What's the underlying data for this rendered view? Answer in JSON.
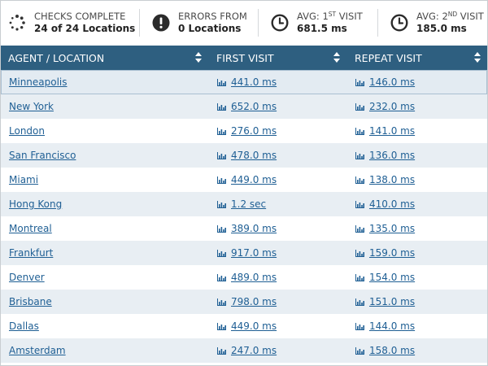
{
  "summary": {
    "checks": {
      "icon": "loading-spinner-icon",
      "label": "CHECKS COMPLETE",
      "value": "24 of 24 Locations"
    },
    "errors": {
      "icon": "error-alert-icon",
      "label": "ERRORS FROM",
      "value": "0 Locations"
    },
    "avg_first": {
      "icon": "clock-icon",
      "label_prefix": "AVG: 1",
      "label_sup": "st",
      "label_suffix": " VISIT",
      "value": "681.5 ms"
    },
    "avg_second": {
      "icon": "clock-icon",
      "label_prefix": "AVG: 2",
      "label_sup": "nd",
      "label_suffix": " VISIT",
      "value": "185.0 ms"
    }
  },
  "table": {
    "header_color": "#2e5f80",
    "columns": [
      {
        "label": "AGENT / LOCATION"
      },
      {
        "label": "FIRST VISIT"
      },
      {
        "label": "REPEAT VISIT"
      }
    ],
    "rows": [
      {
        "location": "Minneapolis",
        "first": "441.0 ms",
        "repeat": "146.0 ms",
        "selected": true
      },
      {
        "location": "New York",
        "first": "652.0 ms",
        "repeat": "232.0 ms"
      },
      {
        "location": "London",
        "first": "276.0 ms",
        "repeat": "141.0 ms"
      },
      {
        "location": "San Francisco",
        "first": "478.0 ms",
        "repeat": "136.0 ms"
      },
      {
        "location": "Miami",
        "first": "449.0 ms",
        "repeat": "138.0 ms"
      },
      {
        "location": "Hong Kong",
        "first": "1.2 sec",
        "repeat": "410.0 ms"
      },
      {
        "location": "Montreal",
        "first": "389.0 ms",
        "repeat": "135.0 ms"
      },
      {
        "location": "Frankfurt",
        "first": "917.0 ms",
        "repeat": "159.0 ms"
      },
      {
        "location": "Denver",
        "first": "489.0 ms",
        "repeat": "154.0 ms"
      },
      {
        "location": "Brisbane",
        "first": "798.0 ms",
        "repeat": "151.0 ms"
      },
      {
        "location": "Dallas",
        "first": "449.0 ms",
        "repeat": "144.0 ms"
      },
      {
        "location": "Amsterdam",
        "first": "247.0 ms",
        "repeat": "158.0 ms"
      }
    ]
  },
  "colors": {
    "link": "#1f5f94",
    "row_alt": "#e8eef3",
    "selected_border": "#a9bfd1"
  }
}
